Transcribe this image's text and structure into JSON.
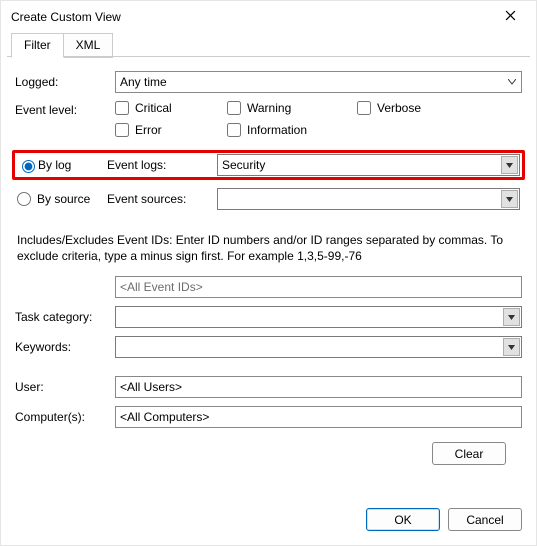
{
  "window": {
    "title": "Create Custom View"
  },
  "tabs": {
    "filter": "Filter",
    "xml": "XML"
  },
  "labels": {
    "logged": "Logged:",
    "event_level": "Event level:",
    "by_log": "By log",
    "by_source": "By source",
    "event_logs": "Event logs:",
    "event_sources": "Event sources:",
    "task_category": "Task category:",
    "keywords": "Keywords:",
    "user": "User:",
    "computers": "Computer(s):"
  },
  "logged": {
    "value": "Any time"
  },
  "levels": {
    "critical": "Critical",
    "warning": "Warning",
    "verbose": "Verbose",
    "error": "Error",
    "information": "Information"
  },
  "event_logs": {
    "value": "Security"
  },
  "event_sources": {
    "value": ""
  },
  "help_text": "Includes/Excludes Event IDs: Enter ID numbers and/or ID ranges separated by commas. To exclude criteria, type a minus sign first. For example 1,3,5-99,-76",
  "event_ids": {
    "placeholder": "<All Event IDs>"
  },
  "task_category": {
    "value": ""
  },
  "keywords": {
    "value": ""
  },
  "user": {
    "value": "<All Users>"
  },
  "computers": {
    "value": "<All Computers>"
  },
  "buttons": {
    "clear": "Clear",
    "ok": "OK",
    "cancel": "Cancel"
  }
}
